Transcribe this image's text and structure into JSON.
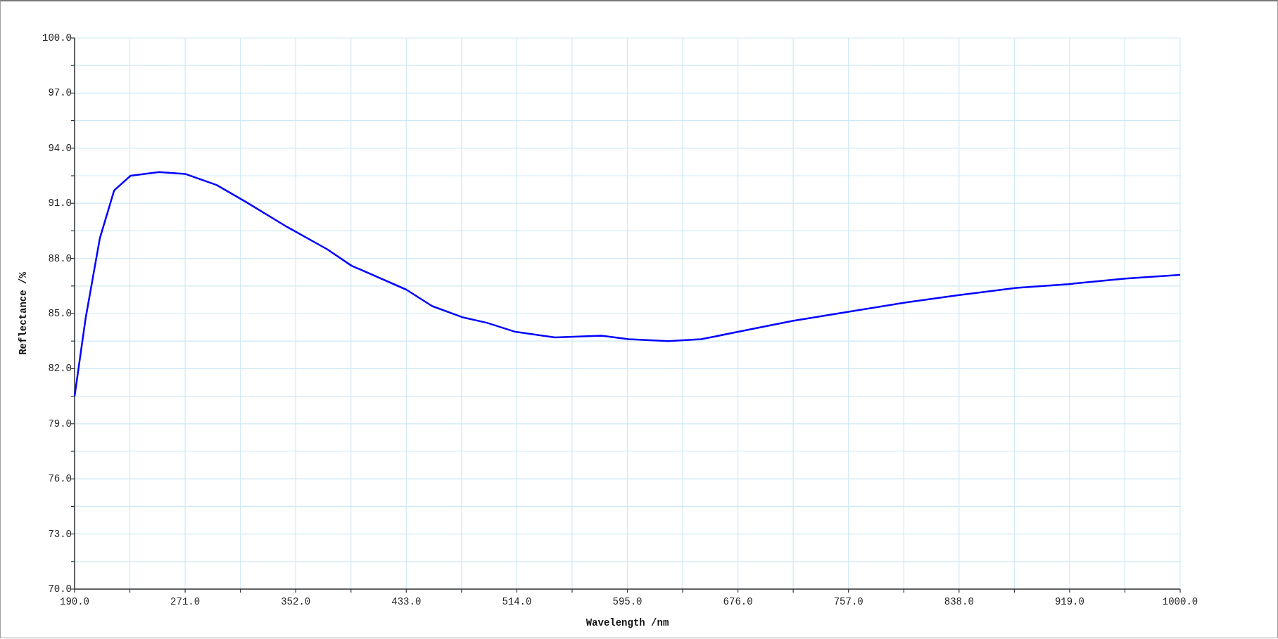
{
  "chart_data": {
    "type": "line",
    "grid": true,
    "xlabel": "Wavelength /nm",
    "ylabel": "Reflectance /%",
    "x": [
      190,
      198,
      208.5,
      219,
      231,
      252,
      271,
      294,
      315,
      346,
      375,
      393,
      433,
      452,
      474,
      492,
      513,
      542,
      576,
      596,
      625,
      649,
      676,
      716,
      757,
      799,
      837,
      880,
      918,
      960,
      1000
    ],
    "series": [
      {
        "color": "#0000ff",
        "values": [
          80.5,
          84.7,
          89.1,
          91.7,
          92.5,
          92.7,
          92.6,
          92.0,
          91.1,
          89.7,
          88.5,
          87.6,
          86.3,
          85.4,
          84.8,
          84.5,
          84.0,
          83.7,
          83.8,
          83.6,
          83.5,
          83.6,
          84.0,
          84.6,
          85.1,
          85.6,
          86.0,
          86.4,
          86.6,
          86.9,
          87.1
        ]
      }
    ],
    "xlim": [
      190,
      1000
    ],
    "ylim": [
      70,
      100
    ],
    "xticks": [
      {
        "value": 190,
        "label": "190.0"
      },
      {
        "value": 271,
        "label": "271.0"
      },
      {
        "value": 352,
        "label": "352.0"
      },
      {
        "value": 433,
        "label": "433.0"
      },
      {
        "value": 514,
        "label": "514.0"
      },
      {
        "value": 595,
        "label": "595.0"
      },
      {
        "value": 676,
        "label": "676.0"
      },
      {
        "value": 757,
        "label": "757.0"
      },
      {
        "value": 838,
        "label": "838.0"
      },
      {
        "value": 919,
        "label": "919.0"
      },
      {
        "value": 1000,
        "label": "1000.0"
      }
    ],
    "yticks": [
      {
        "value": 70,
        "label": "70.0"
      },
      {
        "value": 73,
        "label": "73.0"
      },
      {
        "value": 76,
        "label": "76.0"
      },
      {
        "value": 79,
        "label": "79.0"
      },
      {
        "value": 82,
        "label": "82.0"
      },
      {
        "value": 85,
        "label": "85.0"
      },
      {
        "value": 88,
        "label": "88.0"
      },
      {
        "value": 91,
        "label": "91.0"
      },
      {
        "value": 94,
        "label": "94.0"
      },
      {
        "value": 97,
        "label": "97.0"
      },
      {
        "value": 100,
        "label": "100.0"
      }
    ]
  }
}
